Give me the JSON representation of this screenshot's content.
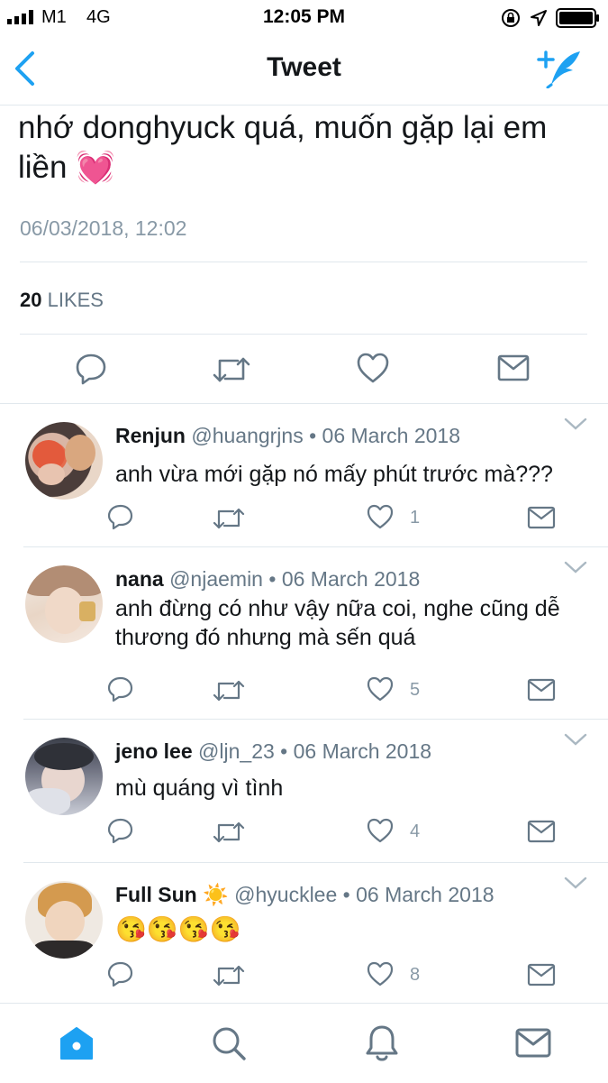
{
  "status_bar": {
    "carrier": "M1",
    "network": "4G",
    "time": "12:05 PM"
  },
  "nav": {
    "title": "Tweet",
    "back_icon": "chevron-left-icon",
    "compose_icon": "compose-feather-icon",
    "accent": "#1da1f2"
  },
  "tweet": {
    "text": "nhớ donghyuck quá, muốn gặp lại em liền 💓",
    "timestamp": "06/03/2018, 12:02",
    "likes_count": "20",
    "likes_label": "LIKES"
  },
  "replies": [
    {
      "name": "Renjun",
      "handle": "@huangrjns",
      "date": "• 06 March 2018",
      "text": "anh vừa mới gặp nó mấy phút trước mà???",
      "likes": "1"
    },
    {
      "name": "nana",
      "handle": "@njaemin",
      "date": "• 06 March 2018",
      "text": "anh đừng có như vậy nữa coi, nghe cũng dễ thương đó nhưng mà sến quá",
      "likes": "5"
    },
    {
      "name": "jeno lee",
      "handle": "@ljn_23",
      "date": "• 06 March 2018",
      "text": "mù quáng vì tình",
      "likes": "4"
    },
    {
      "name": "Full Sun ☀️",
      "handle": "@hyucklee",
      "date": "• 06 March 2018",
      "text": "😘😘😘😘",
      "likes": "8"
    }
  ],
  "tabbar": {
    "items": [
      "home-icon",
      "search-icon",
      "notifications-icon",
      "messages-icon"
    ]
  }
}
